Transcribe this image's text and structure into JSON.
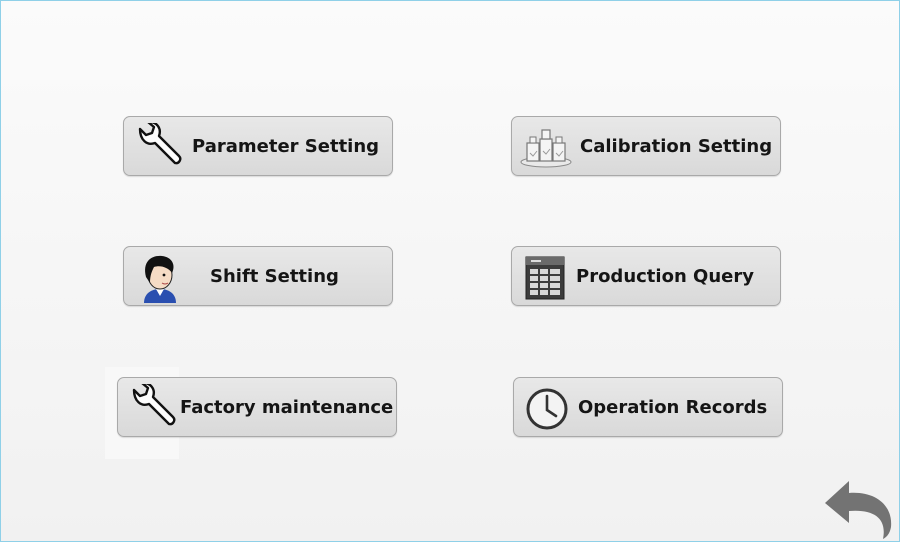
{
  "menu": {
    "parameter_setting": {
      "label": "Parameter Setting",
      "icon": "wrench-icon"
    },
    "calibration_setting": {
      "label": "Calibration Setting",
      "icon": "weights-icon"
    },
    "shift_setting": {
      "label": "Shift Setting",
      "icon": "operator-icon"
    },
    "production_query": {
      "label": "Production Query",
      "icon": "spreadsheet-icon"
    },
    "factory_maintenance": {
      "label": "Factory maintenance",
      "icon": "wrench-icon"
    },
    "operation_records": {
      "label": "Operation Records",
      "icon": "clock-icon"
    }
  },
  "back": {
    "icon": "back-arrow-icon"
  }
}
